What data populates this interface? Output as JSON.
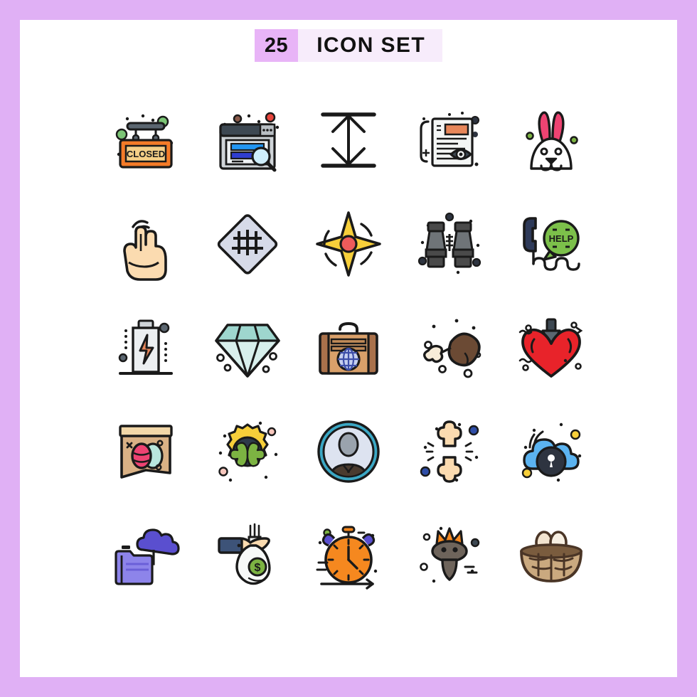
{
  "header": {
    "count": "25",
    "title": "ICON SET"
  },
  "palette": {
    "page_border": "#e0b0f5",
    "page_background": "#ffffff",
    "badge_background": "#e8b4f7",
    "title_background": "#f7ecfb",
    "text": "#111111",
    "outline": "#1a1a1a",
    "orange": "#f47b28",
    "tan": "#f5cf87",
    "pink": "#ee4372",
    "red": "#e8232a",
    "green": "#7cb342",
    "blue": "#2196f3",
    "purple": "#5a4fcf",
    "teal": "#bfe3e0",
    "yellow": "#f7cf3a",
    "brown": "#a9714b",
    "gray": "#5b6670"
  },
  "grid": {
    "columns": 5,
    "rows": 5,
    "total": 25,
    "icons": [
      {
        "index": 1,
        "row": 1,
        "col": 1,
        "name": "closed-sign-icon",
        "label": "Closed Sign",
        "sign_text": "CLOSED",
        "colors": [
          "#f47b28",
          "#f5cf87",
          "#5b6670",
          "#7cc576"
        ]
      },
      {
        "index": 2,
        "row": 1,
        "col": 2,
        "name": "browser-search-icon",
        "label": "Browser Search Window",
        "colors": [
          "#cfd4d8",
          "#3d4852",
          "#2196f3",
          "#2f3ed0",
          "#e8453c"
        ]
      },
      {
        "index": 3,
        "row": 1,
        "col": 3,
        "name": "vertical-resize-icon",
        "label": "Vertical Resize Arrows",
        "colors": [
          "#1a1a1a"
        ]
      },
      {
        "index": 4,
        "row": 1,
        "col": 4,
        "name": "news-preview-eye-icon",
        "label": "News Document Preview",
        "colors": [
          "#f1f3f2",
          "#e8875a",
          "#1a1a1a"
        ]
      },
      {
        "index": 5,
        "row": 1,
        "col": 5,
        "name": "bunny-face-icon",
        "label": "Bunny Rabbit Face",
        "colors": [
          "#ee4372",
          "#ffffff",
          "#1a1a1a",
          "#7cb342"
        ]
      },
      {
        "index": 6,
        "row": 2,
        "col": 1,
        "name": "two-finger-tap-icon",
        "label": "Two Finger Tap Gesture",
        "colors": [
          "#fbdbb0",
          "#1a1a1a"
        ]
      },
      {
        "index": 7,
        "row": 2,
        "col": 2,
        "name": "railway-crossing-icon",
        "label": "Railway Crossing Sign",
        "colors": [
          "#d6dae8",
          "#1a1a1a"
        ]
      },
      {
        "index": 8,
        "row": 2,
        "col": 3,
        "name": "compass-star-icon",
        "label": "Four Point Star Compass",
        "colors": [
          "#f7cf3a",
          "#ee5b5b",
          "#1a1a1a"
        ]
      },
      {
        "index": 9,
        "row": 2,
        "col": 4,
        "name": "binoculars-icon",
        "label": "Binoculars",
        "colors": [
          "#4a4a4a",
          "#6f7478",
          "#1a1a1a"
        ]
      },
      {
        "index": 10,
        "row": 2,
        "col": 5,
        "name": "help-phone-icon",
        "label": "Help Phone Support",
        "bubble_text": "HELP",
        "colors": [
          "#2e3a59",
          "#7cc04a",
          "#1a1a1a"
        ]
      },
      {
        "index": 11,
        "row": 3,
        "col": 1,
        "name": "battery-charge-icon",
        "label": "Battery Charging",
        "colors": [
          "#eceff1",
          "#e8875a",
          "#5b6670",
          "#1a1a1a"
        ]
      },
      {
        "index": 12,
        "row": 3,
        "col": 2,
        "name": "diamond-icon",
        "label": "Diamond Gem",
        "colors": [
          "#d8efec",
          "#8fcfc8",
          "#1a1a1a"
        ]
      },
      {
        "index": 13,
        "row": 3,
        "col": 3,
        "name": "travel-suitcase-icon",
        "label": "Travel Suitcase Globe",
        "colors": [
          "#a9714b",
          "#d9a06a",
          "#3d4ea8",
          "#1a1a1a"
        ]
      },
      {
        "index": 14,
        "row": 3,
        "col": 4,
        "name": "chicken-drumstick-icon",
        "label": "Chicken Drumstick",
        "colors": [
          "#6b4a34",
          "#f7ecd9",
          "#1a1a1a"
        ]
      },
      {
        "index": 15,
        "row": 3,
        "col": 5,
        "name": "heart-dagger-icon",
        "label": "Heart With Dagger",
        "colors": [
          "#e8232a",
          "#5b6670",
          "#1a1a1a"
        ]
      },
      {
        "index": 16,
        "row": 4,
        "col": 1,
        "name": "easter-egg-banner-icon",
        "label": "Easter Egg Banner",
        "colors": [
          "#d9b185",
          "#f2d7a8",
          "#ee4372",
          "#b8e6dd",
          "#1a1a1a"
        ]
      },
      {
        "index": 17,
        "row": 4,
        "col": 2,
        "name": "clover-badge-icon",
        "label": "Four Leaf Clover Badge",
        "colors": [
          "#f7cf3a",
          "#2e3a4a",
          "#7cb342",
          "#f7c7bd"
        ]
      },
      {
        "index": 18,
        "row": 4,
        "col": 3,
        "name": "user-avatar-icon",
        "label": "User Avatar Circle",
        "colors": [
          "#3ba7c4",
          "#dde3f0",
          "#9aa3ad",
          "#4a3b2f"
        ]
      },
      {
        "index": 19,
        "row": 4,
        "col": 4,
        "name": "bone-joint-icon",
        "label": "Bone Joint Pain",
        "colors": [
          "#fbdbb0",
          "#2f4ea8",
          "#1a1a1a"
        ]
      },
      {
        "index": 20,
        "row": 4,
        "col": 5,
        "name": "cloud-lock-icon",
        "label": "Cloud Security Lock",
        "colors": [
          "#5bb3f0",
          "#2e3440",
          "#f7cf3a",
          "#1a1a1a"
        ]
      },
      {
        "index": 21,
        "row": 5,
        "col": 1,
        "name": "cloud-folder-icon",
        "label": "Cloud Folder Transfer",
        "colors": [
          "#5a4fcf",
          "#8d84ea",
          "#1a1a1a"
        ]
      },
      {
        "index": 22,
        "row": 5,
        "col": 2,
        "name": "money-bag-hand-icon",
        "label": "Hand Holding Money Bag",
        "colors": [
          "#3d5378",
          "#fbdbb0",
          "#f1f3f2",
          "#7cb342"
        ]
      },
      {
        "index": 23,
        "row": 5,
        "col": 3,
        "name": "alarm-clock-icon",
        "label": "Alarm Clock",
        "colors": [
          "#f5881f",
          "#5a4fcf",
          "#1a1a1a"
        ]
      },
      {
        "index": 24,
        "row": 5,
        "col": 4,
        "name": "moose-head-icon",
        "label": "Moose Deer Head",
        "colors": [
          "#6e645b",
          "#f5881f",
          "#1a1a1a"
        ]
      },
      {
        "index": 25,
        "row": 5,
        "col": 5,
        "name": "nest-eggs-icon",
        "label": "Bird Nest With Eggs",
        "colors": [
          "#7a5c3e",
          "#f2e3cf",
          "#4a3526"
        ]
      }
    ]
  }
}
